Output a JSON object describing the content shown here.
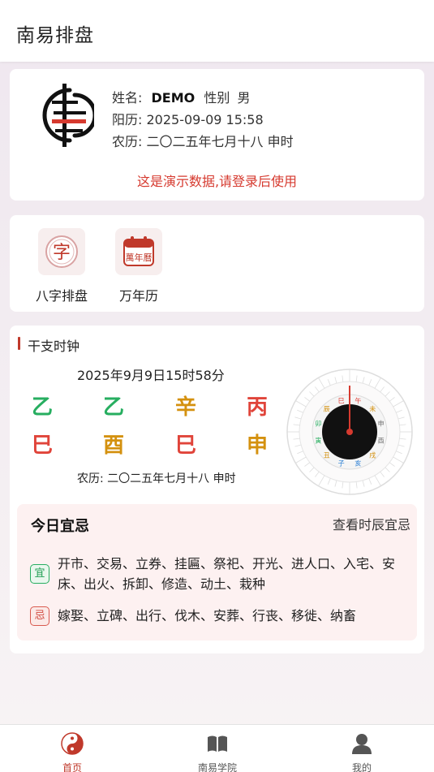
{
  "app": {
    "title": "南易排盘"
  },
  "profile": {
    "name_label": "姓名:",
    "name_value": "DEMO",
    "gender_label": "性别",
    "gender_value": "男",
    "solar": "阳历: 2025-09-09 15:58",
    "lunar": "农历: 二〇二五年七月十八 申时",
    "demo_note": "这是演示数据,请登录后使用"
  },
  "tools": [
    {
      "label": "八字排盘",
      "icon": "bazi-icon"
    },
    {
      "label": "万年历",
      "icon": "calendar-icon"
    }
  ],
  "clock": {
    "title": "干支时钟",
    "date": "2025年9月9日15时58分",
    "stems": [
      {
        "char": "乙",
        "color": "#27ae60"
      },
      {
        "char": "乙",
        "color": "#27ae60"
      },
      {
        "char": "辛",
        "color": "#d4910f"
      },
      {
        "char": "丙",
        "color": "#e0443a"
      }
    ],
    "branches": [
      {
        "char": "巳",
        "color": "#e0443a"
      },
      {
        "char": "酉",
        "color": "#d4910f"
      },
      {
        "char": "巳",
        "color": "#e0443a"
      },
      {
        "char": "申",
        "color": "#d4910f"
      }
    ],
    "lunar": "农历: 二〇二五年七月十八 申时",
    "compass_branches": [
      "午",
      "未",
      "申",
      "酉",
      "戌",
      "亥",
      "子",
      "丑",
      "寅",
      "卯",
      "辰",
      "巳"
    ]
  },
  "yiji": {
    "title": "今日宜忌",
    "more": "查看时辰宜忌",
    "yi_badge": "宜",
    "yi_text": "开市、交易、立券、挂匾、祭祀、开光、进人口、入宅、安床、出火、拆卸、修造、动土、栽种",
    "ji_badge": "忌",
    "ji_text": "嫁娶、立碑、出行、伐木、安葬、行丧、移徙、纳畜"
  },
  "nav": [
    {
      "label": "首页",
      "icon": "yin-yang-icon",
      "active": true
    },
    {
      "label": "南易学院",
      "icon": "book-icon",
      "active": false
    },
    {
      "label": "我的",
      "icon": "user-icon",
      "active": false
    }
  ],
  "colors": {
    "accent": "#c0392b",
    "green": "#27ae60",
    "gold": "#d4910f",
    "red": "#e0443a"
  }
}
